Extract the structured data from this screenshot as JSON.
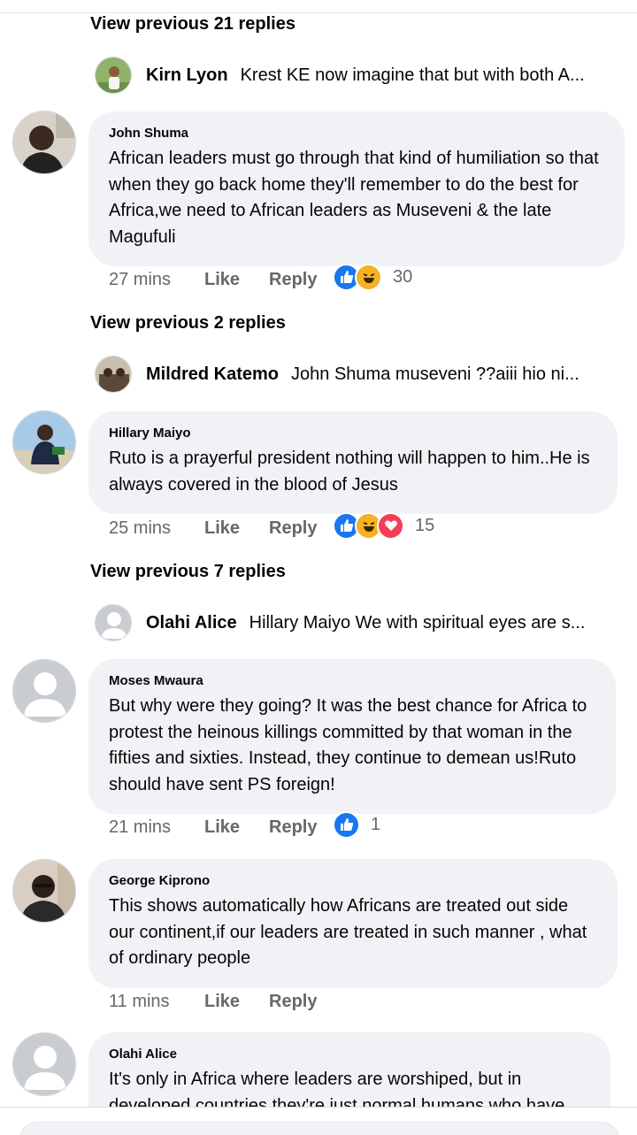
{
  "threads": [
    {
      "view_previous": "View previous 21 replies",
      "reply": {
        "name": "Kirn Lyon",
        "text": "Krest KE now imagine that but with both A..."
      },
      "comment": {
        "author": "John Shuma",
        "text": "African leaders must go through that kind of humiliation so that when they go back home they'll remember to do the best for Africa,we need to African leaders as Museveni & the late Magufuli",
        "time": "27 mins",
        "like": "Like",
        "reply": "Reply",
        "reactions": [
          "like-reaction-icon",
          "haha-reaction-icon"
        ],
        "reaction_count": "30"
      }
    },
    {
      "view_previous": "View previous 2 replies",
      "reply": {
        "name": "Mildred Katemo",
        "text": "John Shuma museveni ??aiii hio ni..."
      },
      "comment": {
        "author": "Hillary Maiyo",
        "text": "Ruto is a prayerful president nothing will happen to him..He is always covered in the blood of Jesus",
        "time": "25 mins",
        "like": "Like",
        "reply": "Reply",
        "reactions": [
          "like-reaction-icon",
          "haha-reaction-icon",
          "love-reaction-icon"
        ],
        "reaction_count": "15"
      }
    },
    {
      "view_previous": "View previous 7 replies",
      "reply": {
        "name": "Olahi Alice",
        "text": "Hillary Maiyo We with spiritual eyes are s..."
      },
      "comment": {
        "author": "Moses Mwaura",
        "text": "But why were they going? It was the best chance for Africa to protest the heinous killings committed by that woman in the fifties and sixties. Instead, they continue to demean us!Ruto should have sent PS foreign!",
        "time": "21 mins",
        "like": "Like",
        "reply": "Reply",
        "reactions": [
          "like-reaction-icon"
        ],
        "reaction_count": "1"
      }
    },
    {
      "comment": {
        "author": "George Kiprono",
        "text": "This shows automatically how Africans are treated out side our continent,if our leaders are treated in such manner , what of ordinary people",
        "time": "11 mins",
        "like": "Like",
        "reply": "Reply"
      }
    },
    {
      "comment": {
        "author": "Olahi Alice",
        "text": "It's only in Africa where leaders are worshiped, but in developed countries they're just normal humans who have"
      }
    }
  ],
  "colors": {
    "like": "#1877f2",
    "haha": "#f7b125",
    "love": "#f33e58",
    "bubble": "#f0f2f5",
    "meta": "#65676b"
  }
}
